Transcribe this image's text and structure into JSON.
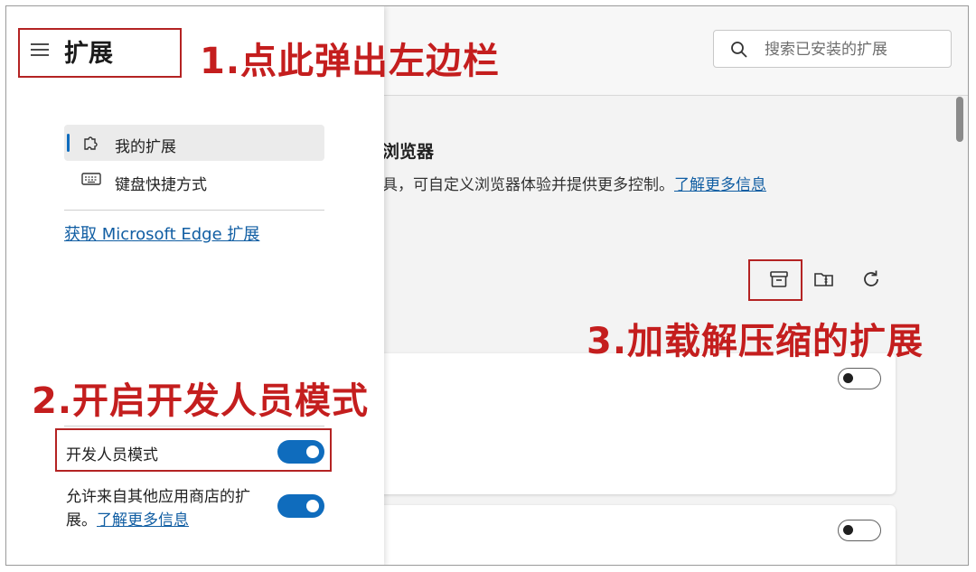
{
  "header": {
    "search_placeholder": "搜索已安装的扩展"
  },
  "sidebar": {
    "title": "扩展",
    "nav": [
      {
        "label": "我的扩展",
        "icon": "puzzle-icon",
        "active": true
      },
      {
        "label": "键盘快捷方式",
        "icon": "keyboard-icon",
        "active": false
      }
    ],
    "get_extensions_link": "获取 Microsoft Edge 扩展",
    "developer_mode": {
      "label": "开发人员模式",
      "enabled": true
    },
    "allow_other_stores": {
      "label_line1": "允许来自其他应用商店的扩",
      "label_line2": "展。",
      "link": "了解更多信息",
      "enabled": true
    }
  },
  "main": {
    "dev_section_title": "浏览器",
    "dev_section_desc": "具，可自定义浏览器体验并提供更多控制。",
    "learn_more": "了解更多信息",
    "toolbar": [
      {
        "name": "load-unpacked-icon"
      },
      {
        "name": "pack-extension-icon"
      },
      {
        "name": "update-icon"
      }
    ],
    "extension_cards": [
      {
        "enabled": false
      },
      {
        "enabled": false
      }
    ]
  },
  "annotations": {
    "step1": "1.点此弹出左边栏",
    "step2": "2.开启开发人员模式",
    "step3": "3.加载解压缩的扩展"
  },
  "colors": {
    "accent": "#0f6cbd",
    "annotation": "#c41e1e",
    "link": "#115ea3"
  }
}
